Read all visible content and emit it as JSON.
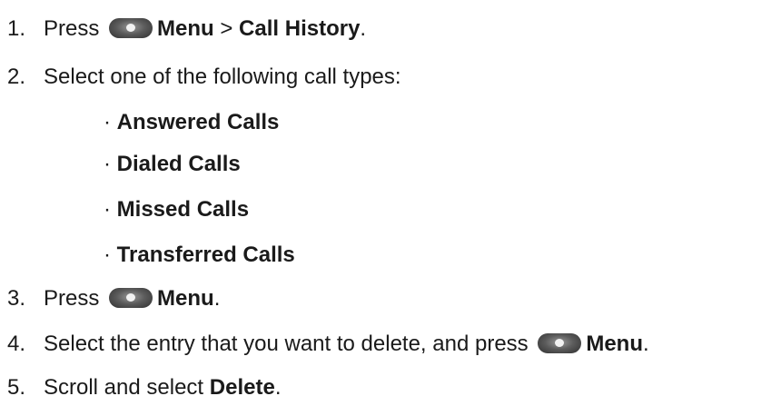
{
  "steps": [
    {
      "number": "1.",
      "text_before": "Press ",
      "menu_label": "Menu",
      "separator": " > ",
      "target": "Call History",
      "end": "."
    },
    {
      "number": "2.",
      "text": "Select one of the following call types:"
    },
    {
      "number": "3.",
      "text_before": "Press ",
      "menu_label": "Menu",
      "end": "."
    },
    {
      "number": "4.",
      "text_before": "Select the entry that you want to delete, and press ",
      "menu_label": "Menu",
      "end": "."
    },
    {
      "number": "5.",
      "text_before": "Scroll and select ",
      "target": "Delete",
      "end": "."
    }
  ],
  "call_types": [
    "Answered Calls",
    "Dialed Calls",
    "Missed Calls",
    "Transferred Calls"
  ],
  "bullet": "·",
  "icon": "menu-button-icon"
}
